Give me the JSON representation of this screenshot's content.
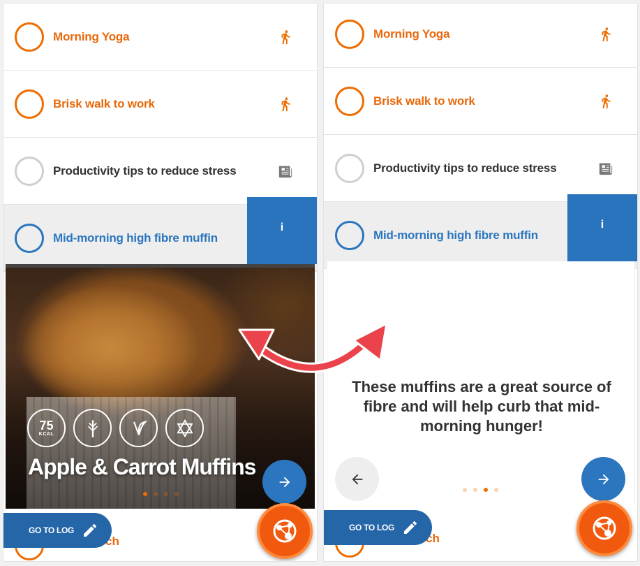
{
  "activities": [
    {
      "title": "Morning Yoga",
      "icon": "running-icon"
    },
    {
      "title": "Brisk walk to work",
      "icon": "running-icon"
    },
    {
      "title": "Productivity tips to reduce stress",
      "icon": "newspaper-icon"
    },
    {
      "title": "Mid-morning high fibre muffin",
      "icon": "info-icon"
    }
  ],
  "info_tab": {
    "label": "i"
  },
  "recipe_card": {
    "title": "Apple & Carrot Muffins",
    "kcal_value": "75",
    "kcal_unit": "KCAL",
    "badges": [
      "calories-badge",
      "wholegrain-icon",
      "vegetarian-leaf-icon",
      "kosher-star-icon"
    ],
    "active_slide_left": 1,
    "active_slide_right": 3,
    "slide_count": 4
  },
  "description": "These muffins are a great source of fibre and will help curb that mid-morning hunger!",
  "go_to_log": {
    "label": "GO TO LOG"
  },
  "peek_item": {
    "left_text": "ch",
    "right_text": "ch"
  },
  "colors": {
    "orange": "#ef6c00",
    "blue": "#2b76be",
    "fab": "#f15a0e",
    "arrow": "#e8434a"
  }
}
